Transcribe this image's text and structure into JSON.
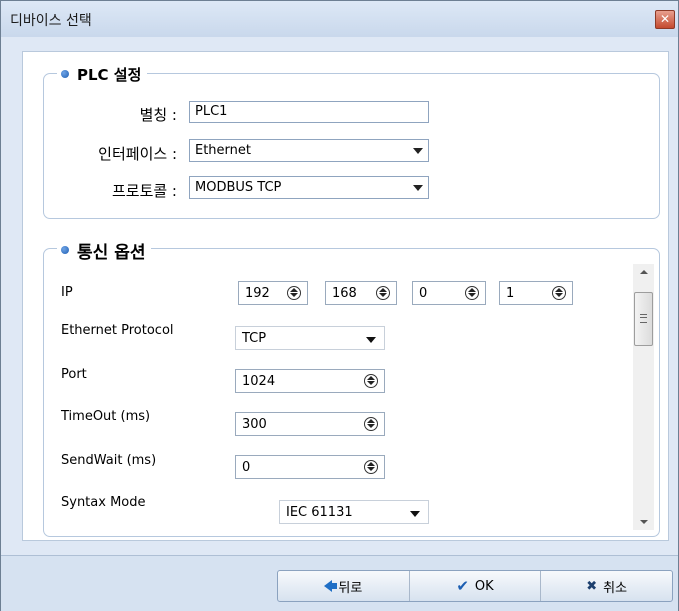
{
  "window": {
    "title": "디바이스 선택",
    "close_icon": "close-icon"
  },
  "plc_group": {
    "title": "PLC 설정",
    "alias_label": "별칭 :",
    "alias_value": "PLC1",
    "interface_label": "인터페이스 :",
    "interface_value": "Ethernet",
    "protocol_label": "프로토콜 :",
    "protocol_value": "MODBUS TCP"
  },
  "comm_group": {
    "title": "통신 옵션",
    "ip_label": "IP",
    "ip": [
      "192",
      "168",
      "0",
      "1"
    ],
    "eth_protocol_label": "Ethernet Protocol",
    "eth_protocol_value": "TCP",
    "port_label": "Port",
    "port_value": "1024",
    "timeout_label": "TimeOut (ms)",
    "timeout_value": "300",
    "sendwait_label": "SendWait (ms)",
    "sendwait_value": "0",
    "syntax_label": "Syntax Mode",
    "syntax_value": "IEC 61131"
  },
  "footer": {
    "back_label": "뒤로",
    "ok_label": "OK",
    "cancel_label": "취소"
  },
  "colors": {
    "accent": "#1f5fb3",
    "window_bg": "#dfe8f5"
  }
}
